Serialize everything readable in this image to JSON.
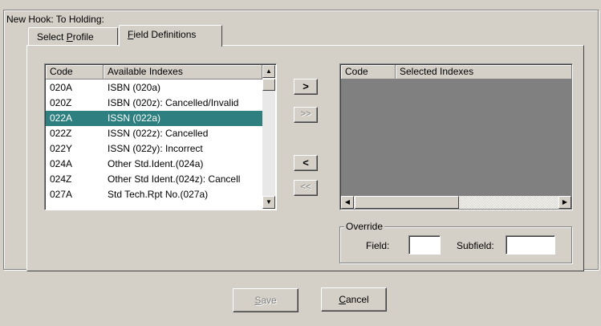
{
  "group": {
    "title": "New Hook: To Holding:"
  },
  "tabs": [
    {
      "pre": "Select ",
      "key": "P",
      "post": "rofile",
      "active": false
    },
    {
      "pre": "",
      "key": "F",
      "post": "ield Definitions",
      "active": true
    }
  ],
  "available": {
    "headers": [
      "Code",
      "Available Indexes"
    ],
    "rows": [
      {
        "code": "020A",
        "name": "ISBN (020a)"
      },
      {
        "code": "020Z",
        "name": "ISBN (020z): Cancelled/Invalid"
      },
      {
        "code": "022A",
        "name": "ISSN (022a)",
        "selected": true
      },
      {
        "code": "022Z",
        "name": "ISSN (022z): Cancelled"
      },
      {
        "code": "022Y",
        "name": "ISSN (022y): Incorrect"
      },
      {
        "code": "024A",
        "name": "Other Std.Ident.(024a)"
      },
      {
        "code": "024Z",
        "name": "Other Std Ident.(024z): Cancell"
      },
      {
        "code": "027A",
        "name": "Std Tech.Rpt No.(027a)"
      }
    ]
  },
  "selected": {
    "headers": [
      "Code",
      "Selected Indexes"
    ]
  },
  "move_buttons": {
    "add": ">",
    "add_all": ">>",
    "remove": "<",
    "remove_all": "<<"
  },
  "override": {
    "title": "Override",
    "field_label": "Field:",
    "subfield_label": "Subfield:",
    "field_value": "",
    "subfield_value": ""
  },
  "buttons": {
    "save": {
      "key": "S",
      "post": "ave",
      "enabled": false
    },
    "cancel": {
      "key": "C",
      "post": "ancel",
      "enabled": true
    }
  },
  "icons": {
    "scroll_up": "triangle-up",
    "scroll_down": "triangle-down",
    "scroll_left": "triangle-left",
    "scroll_right": "triangle-right"
  },
  "colors": {
    "selection": "#2e7f7f",
    "face": "#d4d0c8",
    "list_empty": "#808080"
  }
}
